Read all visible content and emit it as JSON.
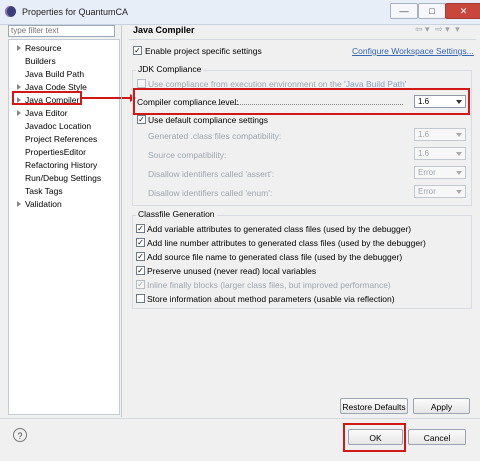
{
  "window": {
    "title": "Properties for QuantumCA",
    "minimize": "—",
    "maximize": "□",
    "close": "✕"
  },
  "sidebar": {
    "filter_placeholder": "type filter text",
    "items": [
      {
        "label": "Resource",
        "has_children": true
      },
      {
        "label": "Builders",
        "has_children": false
      },
      {
        "label": "Java Build Path",
        "has_children": false
      },
      {
        "label": "Java Code Style",
        "has_children": true
      },
      {
        "label": "Java Compiler",
        "has_children": true,
        "selected": true
      },
      {
        "label": "Java Editor",
        "has_children": true
      },
      {
        "label": "Javadoc Location",
        "has_children": false
      },
      {
        "label": "Project References",
        "has_children": false
      },
      {
        "label": "PropertiesEditor",
        "has_children": false
      },
      {
        "label": "Refactoring History",
        "has_children": false
      },
      {
        "label": "Run/Debug Settings",
        "has_children": false
      },
      {
        "label": "Task Tags",
        "has_children": false
      },
      {
        "label": "Validation",
        "has_children": true
      }
    ]
  },
  "page": {
    "title": "Java Compiler",
    "enable_specific": {
      "label": "Enable project specific settings",
      "checked": true
    },
    "configure_link": "Configure Workspace Settings...",
    "jdk_group": {
      "title": "JDK Compliance",
      "use_env_prefix": "Use compliance from execution environment on the ",
      "use_env_link": "'Java Build Path'",
      "use_env_checked": false,
      "compiler_level_label": "Compiler compliance level:",
      "compiler_level_value": "1.6",
      "use_default": {
        "label": "Use default compliance settings",
        "checked": true
      },
      "generated_class_label": "Generated .class files compatibility:",
      "generated_class_value": "1.6",
      "source_label": "Source compatibility:",
      "source_value": "1.6",
      "assert_label": "Disallow identifiers called 'assert':",
      "assert_value": "Error",
      "enum_label": "Disallow identifiers called 'enum':",
      "enum_value": "Error"
    },
    "classfile_group": {
      "title": "Classfile Generation",
      "options": [
        {
          "label": "Add variable attributes to generated class files (used by the debugger)",
          "checked": true,
          "enabled": true
        },
        {
          "label": "Add line number attributes to generated class files (used by the debugger)",
          "checked": true,
          "enabled": true
        },
        {
          "label": "Add source file name to generated class file (used by the debugger)",
          "checked": true,
          "enabled": true
        },
        {
          "label": "Preserve unused (never read) local variables",
          "checked": true,
          "enabled": true
        },
        {
          "label": "Inline finally blocks (larger class files, but improved performance)",
          "checked": true,
          "enabled": false
        },
        {
          "label": "Store information about method parameters (usable via reflection)",
          "checked": false,
          "enabled": true
        }
      ]
    },
    "restore_defaults": "Restore Defaults",
    "apply": "Apply"
  },
  "footer": {
    "help": "?",
    "ok": "OK",
    "cancel": "Cancel"
  },
  "check_mark": "✓",
  "accent_colors": {
    "highlight_red": "#d01818",
    "link_blue": "#3766b5"
  }
}
